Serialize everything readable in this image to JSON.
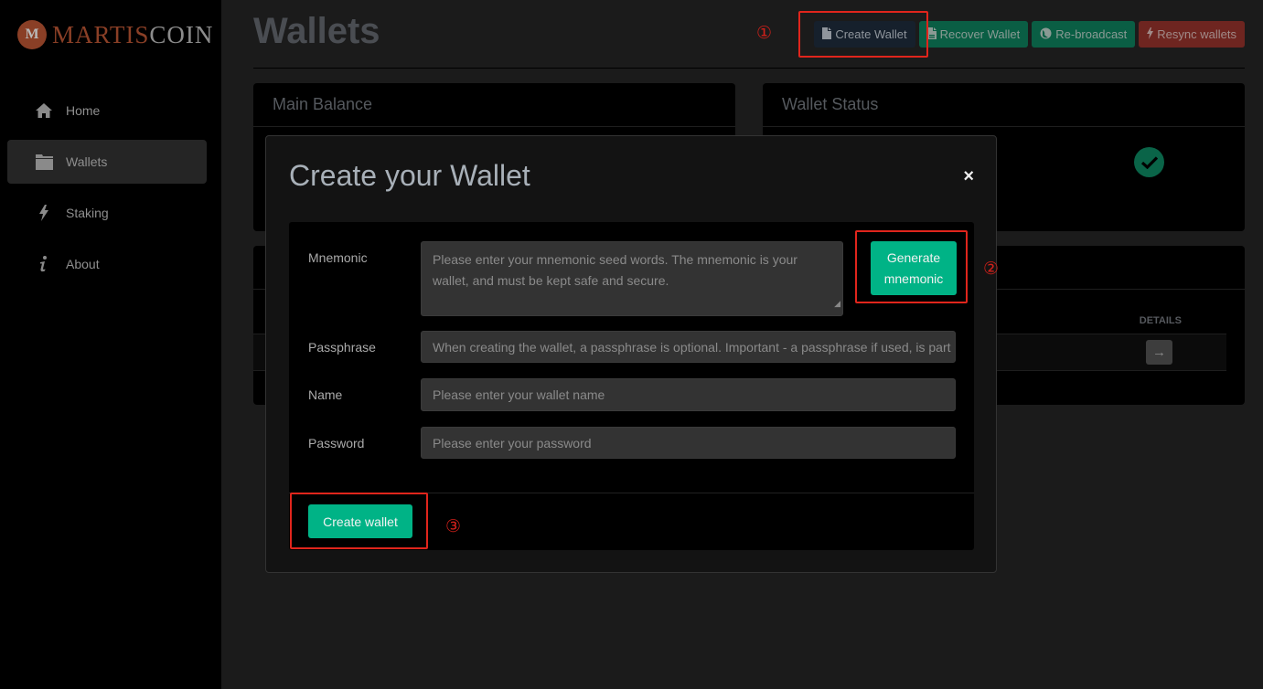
{
  "brand": {
    "badge": "M",
    "name_part1": "MARTIS",
    "name_part2": "COIN"
  },
  "sidebar": {
    "items": [
      {
        "label": "Home",
        "icon": "home-icon",
        "active": false
      },
      {
        "label": "Wallets",
        "icon": "folder-icon",
        "active": true
      },
      {
        "label": "Staking",
        "icon": "bolt-icon",
        "active": false
      },
      {
        "label": "About",
        "icon": "info-icon",
        "active": false
      }
    ]
  },
  "page": {
    "title": "Wallets"
  },
  "toolbar": {
    "create_wallet": "Create Wallet",
    "recover_wallet": "Recover Wallet",
    "rebroadcast": "Re-broadcast",
    "resync_wallets": "Resync wallets"
  },
  "cards": {
    "main_balance": {
      "title": "Main Balance"
    },
    "wallet_status": {
      "title": "Wallet Status",
      "status": "ok"
    },
    "wallets_table": {
      "details_header": "DETAILS",
      "row_action": "→"
    }
  },
  "annotations": {
    "step1": "①",
    "step2": "②",
    "step3": "③"
  },
  "modal": {
    "title": "Create your Wallet",
    "close": "×",
    "fields": {
      "mnemonic": {
        "label": "Mnemonic",
        "placeholder": "Please enter your mnemonic seed words. The mnemonic is your wallet, and must be kept safe and secure."
      },
      "passphrase": {
        "label": "Passphrase",
        "placeholder": "When creating the wallet, a passphrase is optional. Important - a passphrase if used, is part of your wallet"
      },
      "name": {
        "label": "Name",
        "placeholder": "Please enter your wallet name"
      },
      "password": {
        "label": "Password",
        "placeholder": "Please enter your password"
      }
    },
    "generate_button": "Generate mnemonic",
    "create_button": "Create wallet"
  },
  "colors": {
    "accent_green": "#00b386",
    "status_green": "#0a6448",
    "danger_red": "#6e2520",
    "annotation_red": "#e0251c",
    "brand_copper": "#8a3f26"
  }
}
